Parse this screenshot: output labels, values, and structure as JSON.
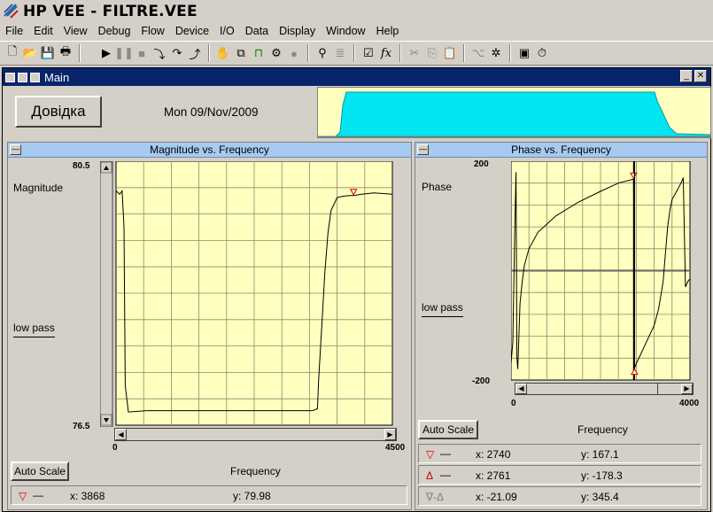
{
  "app": {
    "title": "HP VEE - FILTRE.VEE"
  },
  "menu": [
    "File",
    "Edit",
    "View",
    "Debug",
    "Flow",
    "Device",
    "I/O",
    "Data",
    "Display",
    "Window",
    "Help"
  ],
  "toolbar": {
    "icons": [
      "new-file-icon",
      "open-folder-icon",
      "save-icon",
      "print-icon",
      "run-icon",
      "pause-icon",
      "stop-icon",
      "step-into-icon",
      "step-over-icon",
      "step-out-icon",
      "hand-icon",
      "cut-panel-icon",
      "connect-icon",
      "debug-icon",
      "circle-icon",
      "binoculars-icon",
      "properties-icon",
      "settings-icon",
      "function-icon",
      "scissors-icon",
      "copy-icon",
      "paste-icon",
      "tree-icon",
      "gear-icon",
      "panel-icon",
      "clock-icon"
    ]
  },
  "main_window": {
    "title": "Main",
    "help_button": "Довідка",
    "date": "Mon 09/Nov/2009"
  },
  "colors": {
    "accent": "#08246b",
    "plot_bg": "#ffffc0",
    "panel_head": "#a6caf0",
    "overview_fill": "#00e5ef"
  },
  "magnitude_panel": {
    "title": "Magnitude vs. Frequency",
    "y_label": "Magnitude",
    "trace_label": "low pass",
    "auto_scale": "Auto Scale",
    "x_axis_label": "Frequency",
    "y_max": "80.5",
    "y_min": "76.5",
    "x_min": "0",
    "x_max": "4500",
    "marker_x": "x: 3868",
    "marker_y": "y: 79.98"
  },
  "phase_panel": {
    "title": "Phase vs. Frequency",
    "y_label": "Phase",
    "trace_label": "low pass",
    "auto_scale": "Auto Scale",
    "x_axis_label": "Frequency",
    "y_max": "200",
    "y_min": "-200",
    "x_min": "0",
    "x_max": "4000",
    "marker1_x": "x: 2740",
    "marker1_y": "y: 167.1",
    "marker2_x": "x: 2761",
    "marker2_y": "y: -178.3",
    "delta_symbol": "∇-Δ",
    "delta_x": "x: -21.09",
    "delta_y": "y: 345.4"
  },
  "chart_data": [
    {
      "type": "line",
      "title": "Magnitude vs. Frequency",
      "xlabel": "Frequency",
      "ylabel": "Magnitude",
      "xlim": [
        0,
        4500
      ],
      "ylim": [
        76.5,
        80.5
      ],
      "series": [
        {
          "name": "low pass",
          "x": [
            0,
            60,
            100,
            130,
            150,
            200,
            500,
            1000,
            1500,
            2000,
            2500,
            3000,
            3200,
            3280,
            3300,
            3350,
            3400,
            3450,
            3500,
            3600,
            3700,
            3800,
            3868,
            4000,
            4200,
            4500
          ],
          "y": [
            80.05,
            80.0,
            80.05,
            79.5,
            77.1,
            76.7,
            76.72,
            76.72,
            76.72,
            76.72,
            76.72,
            76.72,
            76.72,
            76.75,
            77.2,
            78.0,
            78.8,
            79.4,
            79.75,
            79.95,
            79.97,
            79.98,
            79.98,
            80.0,
            80.02,
            80.0
          ]
        }
      ],
      "marker": {
        "x": 3868,
        "y": 79.98
      },
      "grid": true
    },
    {
      "type": "line",
      "title": "Phase vs. Frequency",
      "xlabel": "Frequency",
      "ylabel": "Phase",
      "xlim": [
        0,
        4000
      ],
      "ylim": [
        -200,
        200
      ],
      "series": [
        {
          "name": "low pass",
          "x": [
            0,
            40,
            80,
            110,
            130,
            150,
            200,
            250,
            300,
            400,
            600,
            1000,
            1500,
            2000,
            2400,
            2740,
            2761,
            2800,
            3000,
            3200,
            3300,
            3400,
            3450,
            3500,
            3550,
            3600,
            3700,
            3800,
            3850,
            3900,
            3950,
            4000
          ],
          "y": [
            -170,
            -130,
            60,
            180,
            -160,
            -180,
            -60,
            -20,
            10,
            40,
            70,
            100,
            125,
            145,
            160,
            167.1,
            -178.3,
            -170,
            -135,
            -100,
            -70,
            -20,
            30,
            80,
            110,
            130,
            145,
            160,
            170,
            -30,
            -20,
            -15
          ]
        }
      ],
      "markers": [
        {
          "x": 2740,
          "y": 167.1
        },
        {
          "x": 2761,
          "y": -178.3
        }
      ],
      "grid": true
    }
  ]
}
